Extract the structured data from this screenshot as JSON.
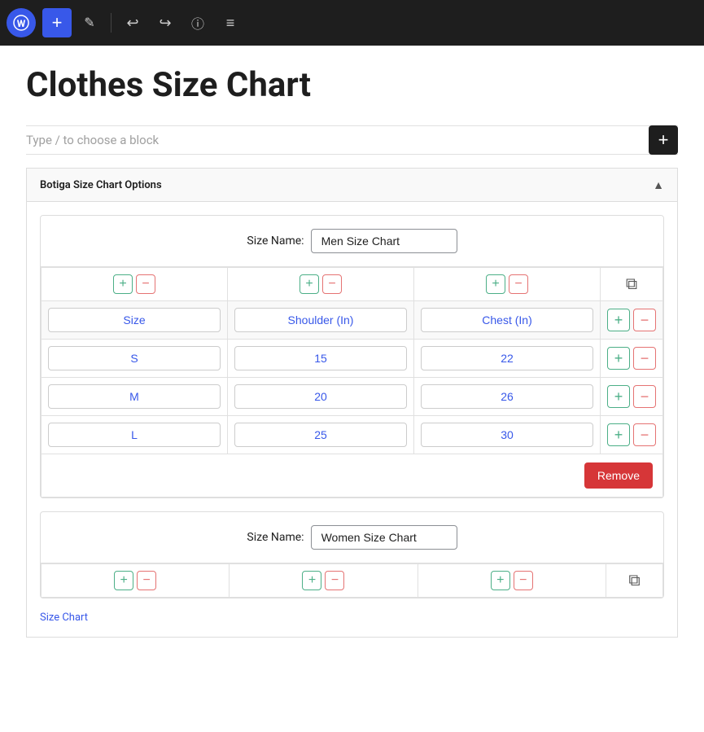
{
  "toolbar": {
    "wp_logo_label": "WordPress",
    "add_btn_label": "+",
    "edit_btn_label": "✎",
    "undo_btn_label": "↩",
    "redo_btn_label": "↪",
    "info_btn_label": "ℹ",
    "list_btn_label": "≡"
  },
  "page": {
    "title": "Clothes Size Chart",
    "block_placeholder": "Type / to choose a block"
  },
  "options_panel": {
    "title": "Botiga Size Chart Options",
    "collapse_icon": "▲"
  },
  "charts": [
    {
      "size_name_label": "Size Name:",
      "size_name_value": "Men Size Chart",
      "columns": [
        "Size",
        "Shoulder (In)",
        "Chest (In)"
      ],
      "rows": [
        {
          "cells": [
            "S",
            "15",
            "22"
          ]
        },
        {
          "cells": [
            "M",
            "20",
            "26"
          ]
        },
        {
          "cells": [
            "L",
            "25",
            "30"
          ]
        }
      ],
      "remove_btn_label": "Remove"
    },
    {
      "size_name_label": "Size Name:",
      "size_name_value": "Women Size Chart",
      "columns": [],
      "rows": []
    }
  ],
  "footer": {
    "link_text": "Size Chart"
  },
  "buttons": {
    "plus": "+",
    "minus": "−",
    "copy_icon": "⧉"
  }
}
